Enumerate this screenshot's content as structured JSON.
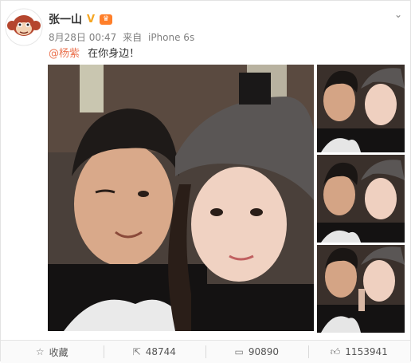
{
  "post": {
    "author": "张一山",
    "vip_mark": "V",
    "time": "8月28日 00:47",
    "source_prefix": "来自",
    "source": "iPhone 6s",
    "mention": "@杨紫",
    "text": "在你身边！"
  },
  "actions": {
    "favorite_label": "收藏",
    "repost_count": "48744",
    "comment_count": "90890",
    "like_count": "1153941"
  },
  "colors": {
    "mention": "#eb7350",
    "vip": "#f5a623"
  },
  "icons": {
    "favorite": "star-icon",
    "repost": "share-icon",
    "comment": "comment-icon",
    "like": "thumbs-up-icon",
    "menu": "chevron-down-icon"
  }
}
